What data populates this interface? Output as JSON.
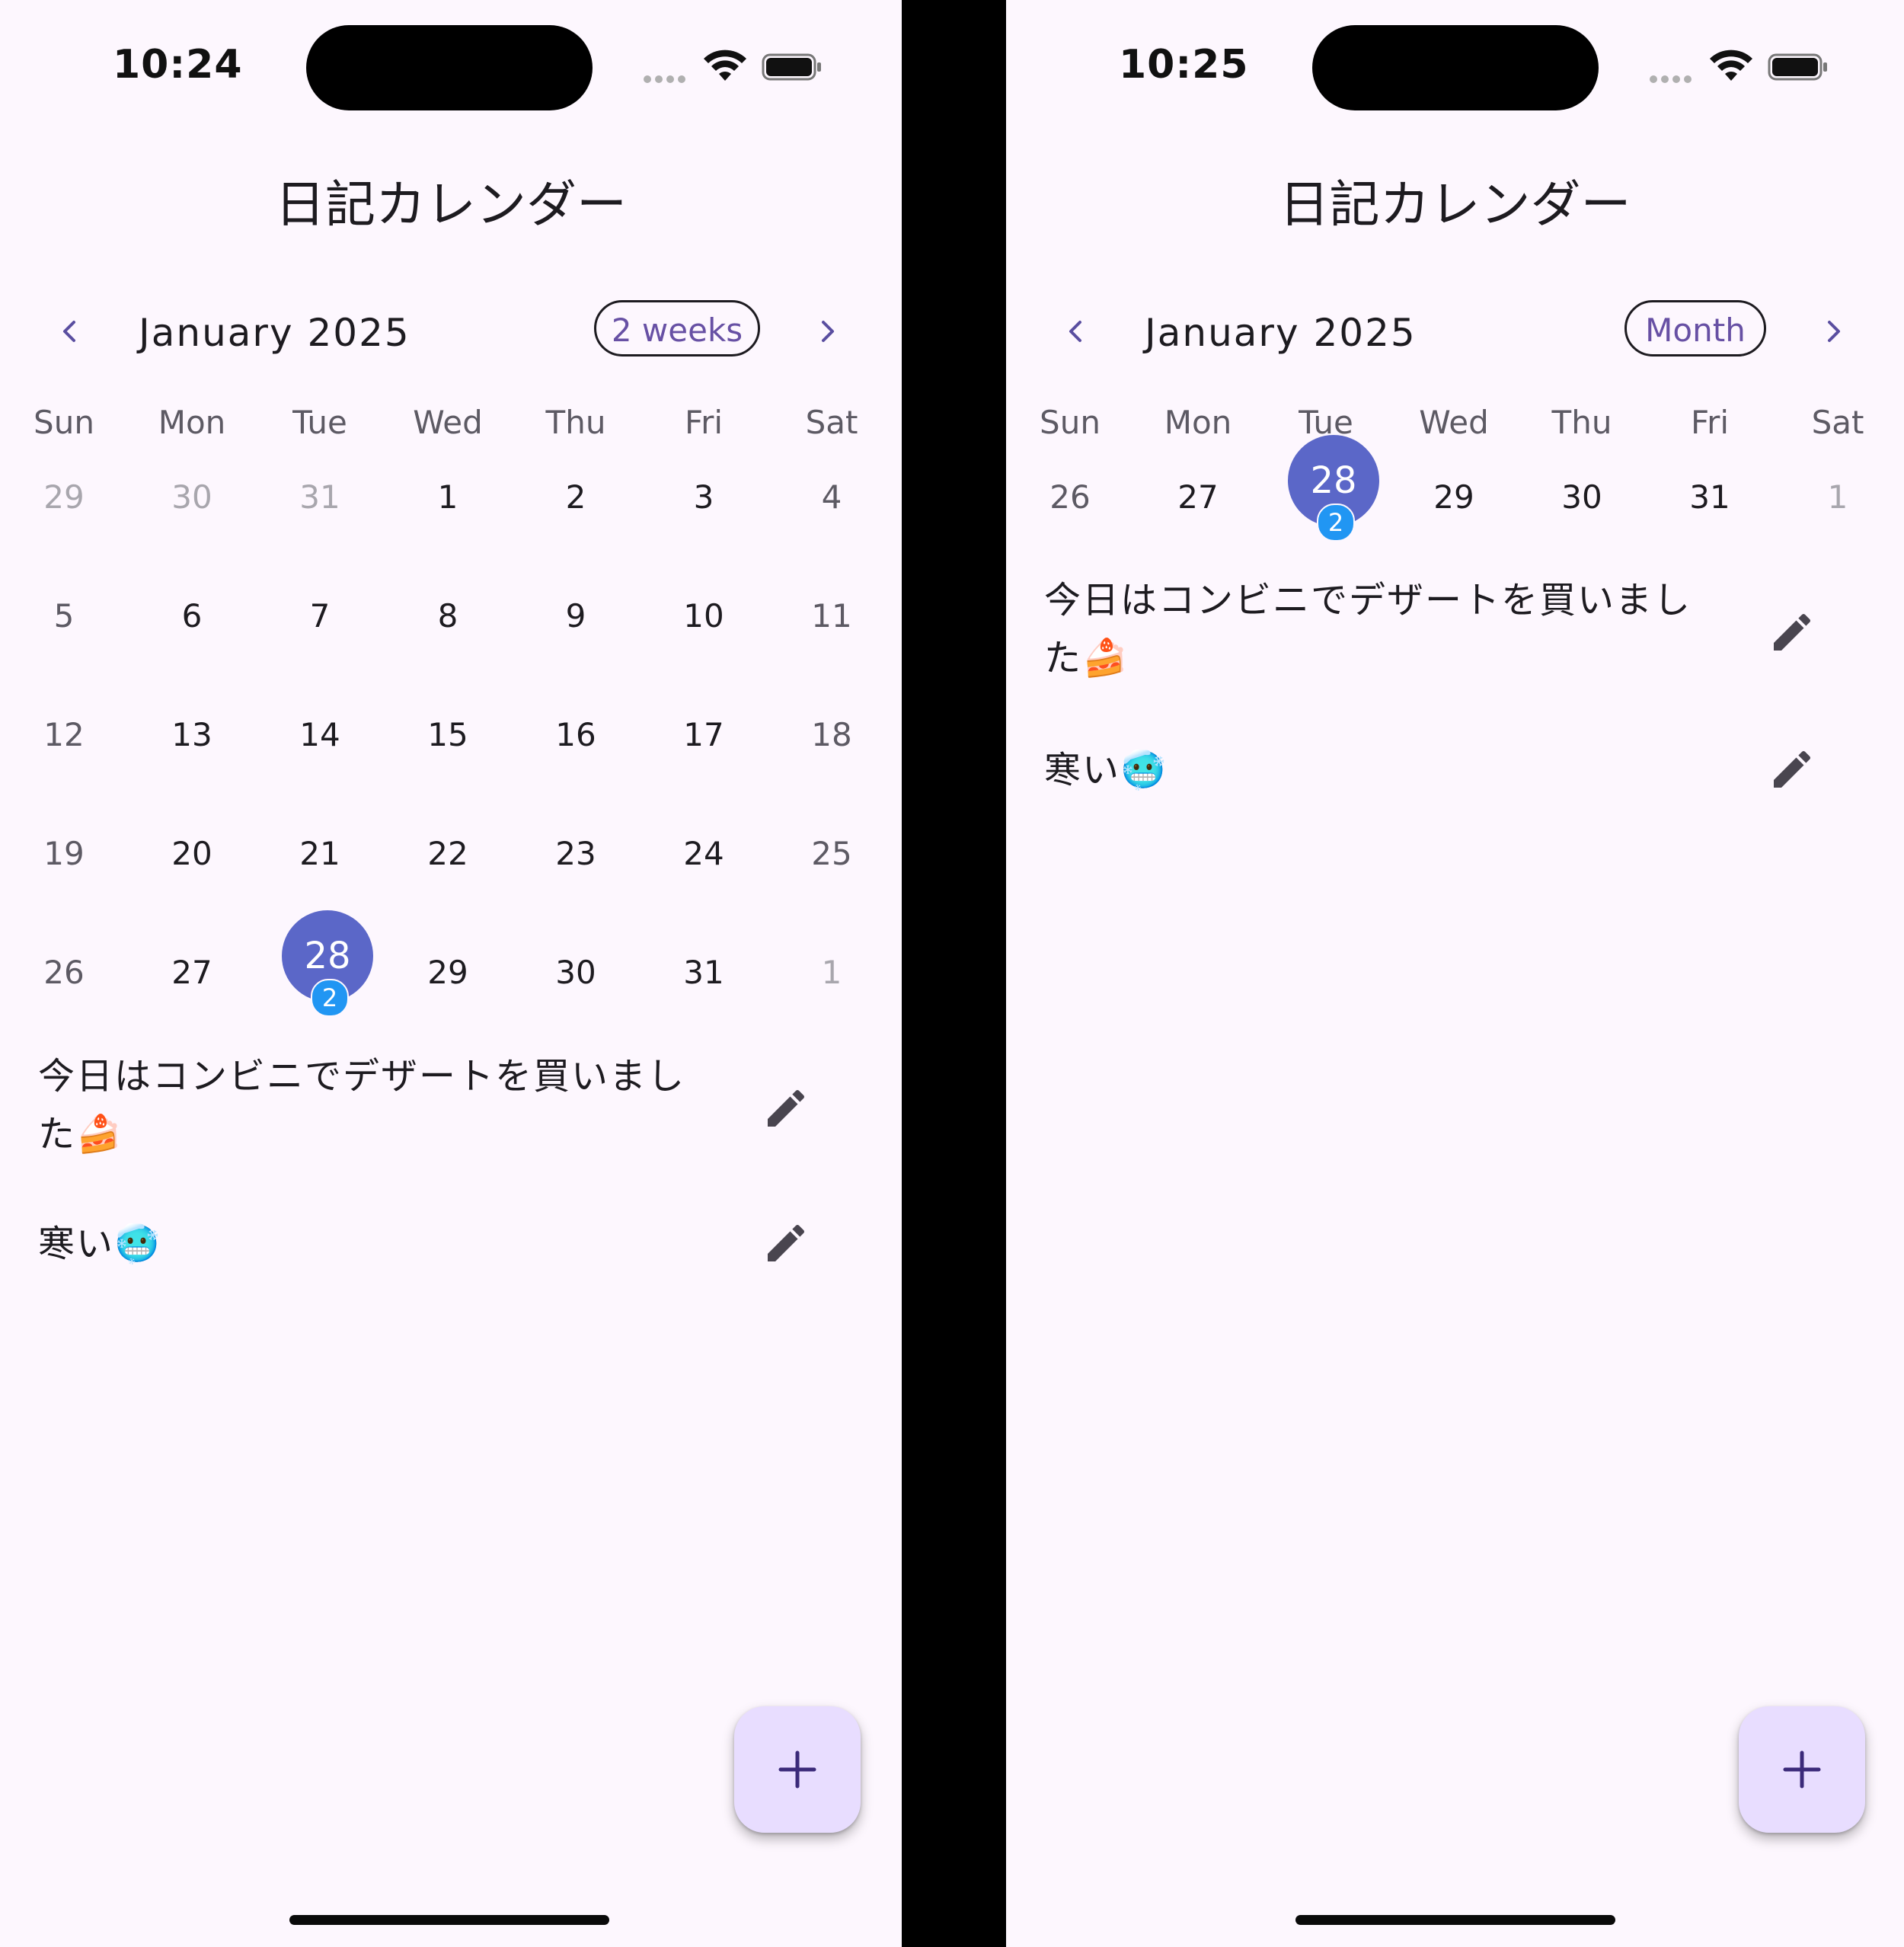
{
  "colors": {
    "accent": "#5b67c8",
    "badge": "#2196f3",
    "background": "#fdf7fe",
    "fab": "#e8ddff",
    "format_button_text": "#6750a4"
  },
  "screens": [
    {
      "status_time": "10:24",
      "title": "日記カレンダー",
      "month_label": "January 2025",
      "format_button": "2 weeks",
      "weekdays": [
        "Sun",
        "Mon",
        "Tue",
        "Wed",
        "Thu",
        "Fri",
        "Sat"
      ],
      "weeks": [
        [
          "29",
          "30",
          "31",
          "1",
          "2",
          "3",
          "4"
        ],
        [
          "5",
          "6",
          "7",
          "8",
          "9",
          "10",
          "11"
        ],
        [
          "12",
          "13",
          "14",
          "15",
          "16",
          "17",
          "18"
        ],
        [
          "19",
          "20",
          "21",
          "22",
          "23",
          "24",
          "25"
        ],
        [
          "26",
          "27",
          "28",
          "29",
          "30",
          "31",
          "1"
        ]
      ],
      "selected_day": "28",
      "selected_badge": "2",
      "entries": [
        {
          "text": "今日はコンビニでデザートを買いました🍰"
        },
        {
          "text": "寒い🥶"
        }
      ]
    },
    {
      "status_time": "10:25",
      "title": "日記カレンダー",
      "month_label": "January 2025",
      "format_button": "Month",
      "weekdays": [
        "Sun",
        "Mon",
        "Tue",
        "Wed",
        "Thu",
        "Fri",
        "Sat"
      ],
      "weeks": [
        [
          "26",
          "27",
          "28",
          "29",
          "30",
          "31",
          "1"
        ]
      ],
      "selected_day": "28",
      "selected_badge": "2",
      "entries": [
        {
          "text": "今日はコンビニでデザートを買いました🍰"
        },
        {
          "text": "寒い🥶"
        }
      ]
    }
  ]
}
